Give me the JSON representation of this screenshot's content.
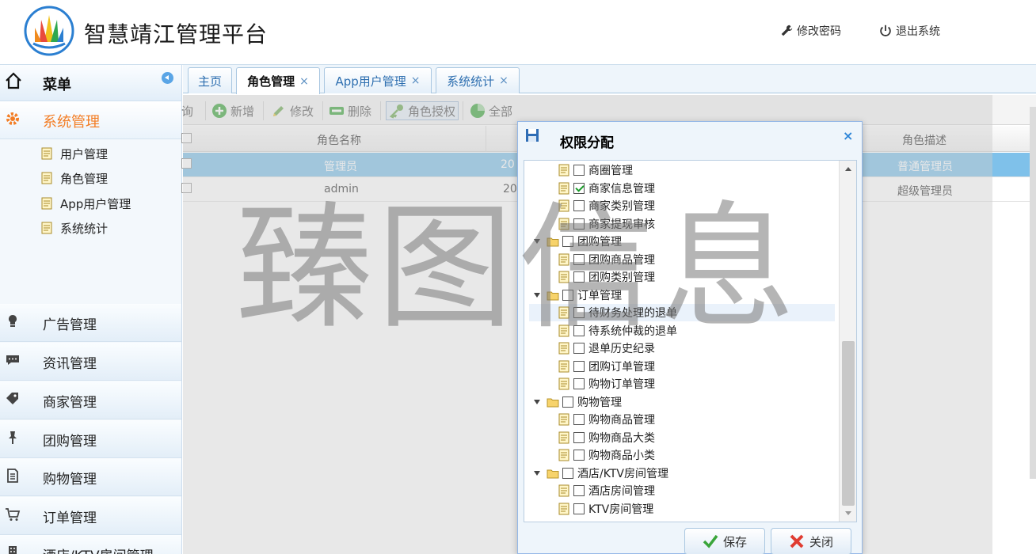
{
  "header": {
    "app_title": "智慧靖江管理平台",
    "change_password": "修改密码",
    "logout": "退出系统"
  },
  "sidebar": {
    "menu_label": "菜单",
    "active_group": "系统管理",
    "sub_items": [
      "用户管理",
      "角色管理",
      "App用户管理",
      "系统统计"
    ],
    "groups": [
      "广告管理",
      "资讯管理",
      "商家管理",
      "团购管理",
      "购物管理",
      "订单管理",
      "酒店/KTV房间管理"
    ]
  },
  "tabs": [
    {
      "label": "主页",
      "closable": false
    },
    {
      "label": "角色管理",
      "closable": true,
      "active": true
    },
    {
      "label": "App用户管理",
      "closable": true
    },
    {
      "label": "系统统计",
      "closable": true
    }
  ],
  "tab_close_glyph": "×",
  "toolbar": {
    "query_partial": "询",
    "add": "新增",
    "edit": "修改",
    "delete": "删除",
    "grant": "角色授权",
    "all": "全部"
  },
  "grid": {
    "col_name": "角色名称",
    "col_desc": "角色描述",
    "rows": [
      {
        "name": "管理员",
        "date_partial": "20",
        "desc": "普通管理员",
        "selected": true
      },
      {
        "name": "admin",
        "date_partial": "20",
        "desc": "超级管理员",
        "selected": false
      }
    ]
  },
  "dialog": {
    "title": "权限分配",
    "close_glyph": "×",
    "save": "保存",
    "close": "关闭",
    "tree": [
      {
        "label": "商圈管理",
        "level": 1,
        "checked": false
      },
      {
        "label": "商家信息管理",
        "level": 1,
        "checked": true
      },
      {
        "label": "商家类别管理",
        "level": 1,
        "checked": false
      },
      {
        "label": "商家提现审核",
        "level": 1,
        "checked": false
      },
      {
        "label": "团购管理",
        "level": 0,
        "checked": false
      },
      {
        "label": "团购商品管理",
        "level": 1,
        "checked": false
      },
      {
        "label": "团购类别管理",
        "level": 1,
        "checked": false
      },
      {
        "label": "订单管理",
        "level": 0,
        "checked": false
      },
      {
        "label": "待财务处理的退单",
        "level": 1,
        "checked": false,
        "hover": true
      },
      {
        "label": "待系统仲裁的退单",
        "level": 1,
        "checked": false
      },
      {
        "label": "退单历史纪录",
        "level": 1,
        "checked": false
      },
      {
        "label": "团购订单管理",
        "level": 1,
        "checked": false
      },
      {
        "label": "购物订单管理",
        "level": 1,
        "checked": false
      },
      {
        "label": "购物管理",
        "level": 0,
        "checked": false
      },
      {
        "label": "购物商品管理",
        "level": 1,
        "checked": false
      },
      {
        "label": "购物商品大类",
        "level": 1,
        "checked": false
      },
      {
        "label": "购物商品小类",
        "level": 1,
        "checked": false
      },
      {
        "label": "酒店/KTV房间管理",
        "level": 0,
        "checked": false
      },
      {
        "label": "酒店房间管理",
        "level": 1,
        "checked": false
      },
      {
        "label": "KTV房间管理",
        "level": 1,
        "checked": false
      }
    ]
  },
  "watermark": "臻图信息",
  "colors": {
    "accent_orange": "#f37d24",
    "tab_blue": "#2e6fb0",
    "row_selected": "#7fc1ea",
    "border_blue": "#95b8e7"
  }
}
